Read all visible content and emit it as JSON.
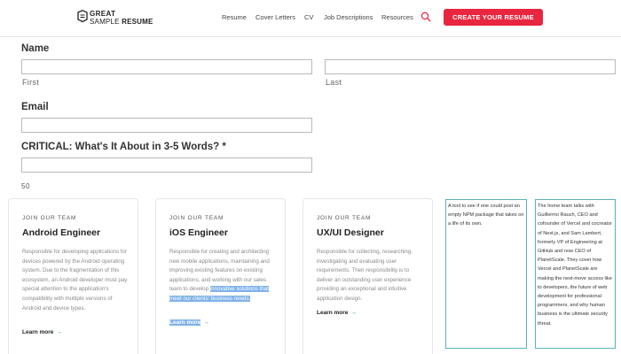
{
  "logo": {
    "line1": "GREAT",
    "line2a": "SAMPLE ",
    "line2b": "RESUME"
  },
  "nav": [
    "Resume",
    "Cover Letters",
    "CV",
    "Job Descriptions",
    "Resources"
  ],
  "cta_label": "CREATE YOUR RESUME",
  "form": {
    "name_label": "Name",
    "first_label": "First",
    "last_label": "Last",
    "email_label": "Email",
    "critical_label": "CRITICAL: What's It About in 3-5 Words? *",
    "counter": "50"
  },
  "cards": [
    {
      "kicker": "JOIN OUR TEAM",
      "title": "Android Engineer",
      "desc": "Responsible for developing applications for devices powered by the Android operating system. Due to the fragmentation of this ecosystem, an Android developer must pay special attention to the application's compatibility with multiple versions of Android and device types.",
      "more": "Learn more"
    },
    {
      "kicker": "JOIN OUR TEAM",
      "title": "iOS Engineer",
      "desc_plain": "Responsible for creating and architecting new mobile applications, maintaining and improving existing features on existing applications, and working with our sales team to develop ",
      "desc_highlight": "innovative solutions that meet our clients' business needs.",
      "more": "Learn more"
    },
    {
      "kicker": "JOIN OUR TEAM",
      "title": "UX/UI Designer",
      "desc": "Responsible for collecting, researching, investigating and evaluating user requirements. Their responsibility is to deliver an outstanding user experience providing an exceptional and intuitive application design.",
      "more": "Learn more"
    }
  ],
  "textboxes": [
    "A tool to see if one could post an empty NPM package that takes on a life of its own.",
    "The home team talks with Guillermo Rauch, CEO and cofounder of Vercel and cocreator of Next.js, and Sam Lambert, formerly VP of Engineering at GitHub and now CEO of PlanetScale. They cover how Vercel and PlanetScale are making the next-move access like to developers, the future of web development for professional programmers, and why human business is the ultimate security threat."
  ],
  "colors": {
    "accent": "#e8263f",
    "link_arrow": "#2a8fa0",
    "highlight": "#7fb2ea",
    "textbox_border": "#59b3b8"
  },
  "icons": [
    "logo-icon",
    "search-icon",
    "arrow-right-icon"
  ]
}
